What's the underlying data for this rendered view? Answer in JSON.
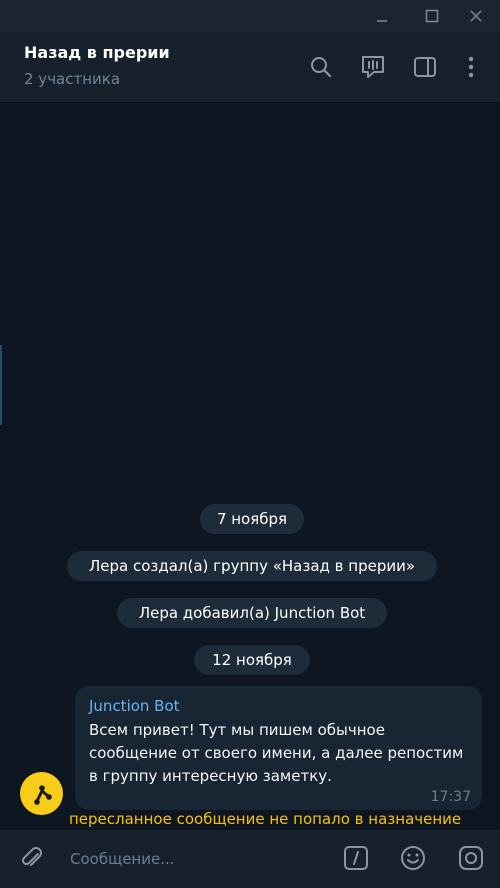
{
  "header": {
    "title": "Назад в прерии",
    "subtitle": "2 участника"
  },
  "messages": {
    "date1": "7 ноября",
    "service1": "Лера создал(а) группу «Назад в прерии»",
    "service2": "Лера добавил(а) Junction Bot",
    "date2": "12 ноября",
    "bubble": {
      "author": "Junction Bot",
      "text": "Всем привет! Тут мы пишем обычное сообщение от своего имени, а далее репостим в группу интересную заметку.",
      "time": "17:37"
    },
    "overlay_note": "пересланное сообщение не попало в назначение"
  },
  "composer": {
    "placeholder": "Сообщение..."
  },
  "icons": {
    "minimize": "minimize-icon",
    "maximize": "maximize-icon",
    "close": "close-icon",
    "search": "search-icon",
    "voice_chat": "voice-chat-icon",
    "sidebar": "sidebar-toggle-icon",
    "more": "more-vertical-icon",
    "attach": "paperclip-icon",
    "commands": "slash-command-icon",
    "emoji": "emoji-icon",
    "camera": "instagram-camera-icon"
  },
  "colors": {
    "background": "#0e1621",
    "header": "#17212b",
    "accent": "#6ab3f3",
    "note": "#f5c400",
    "avatar": "#f7cd1a"
  }
}
